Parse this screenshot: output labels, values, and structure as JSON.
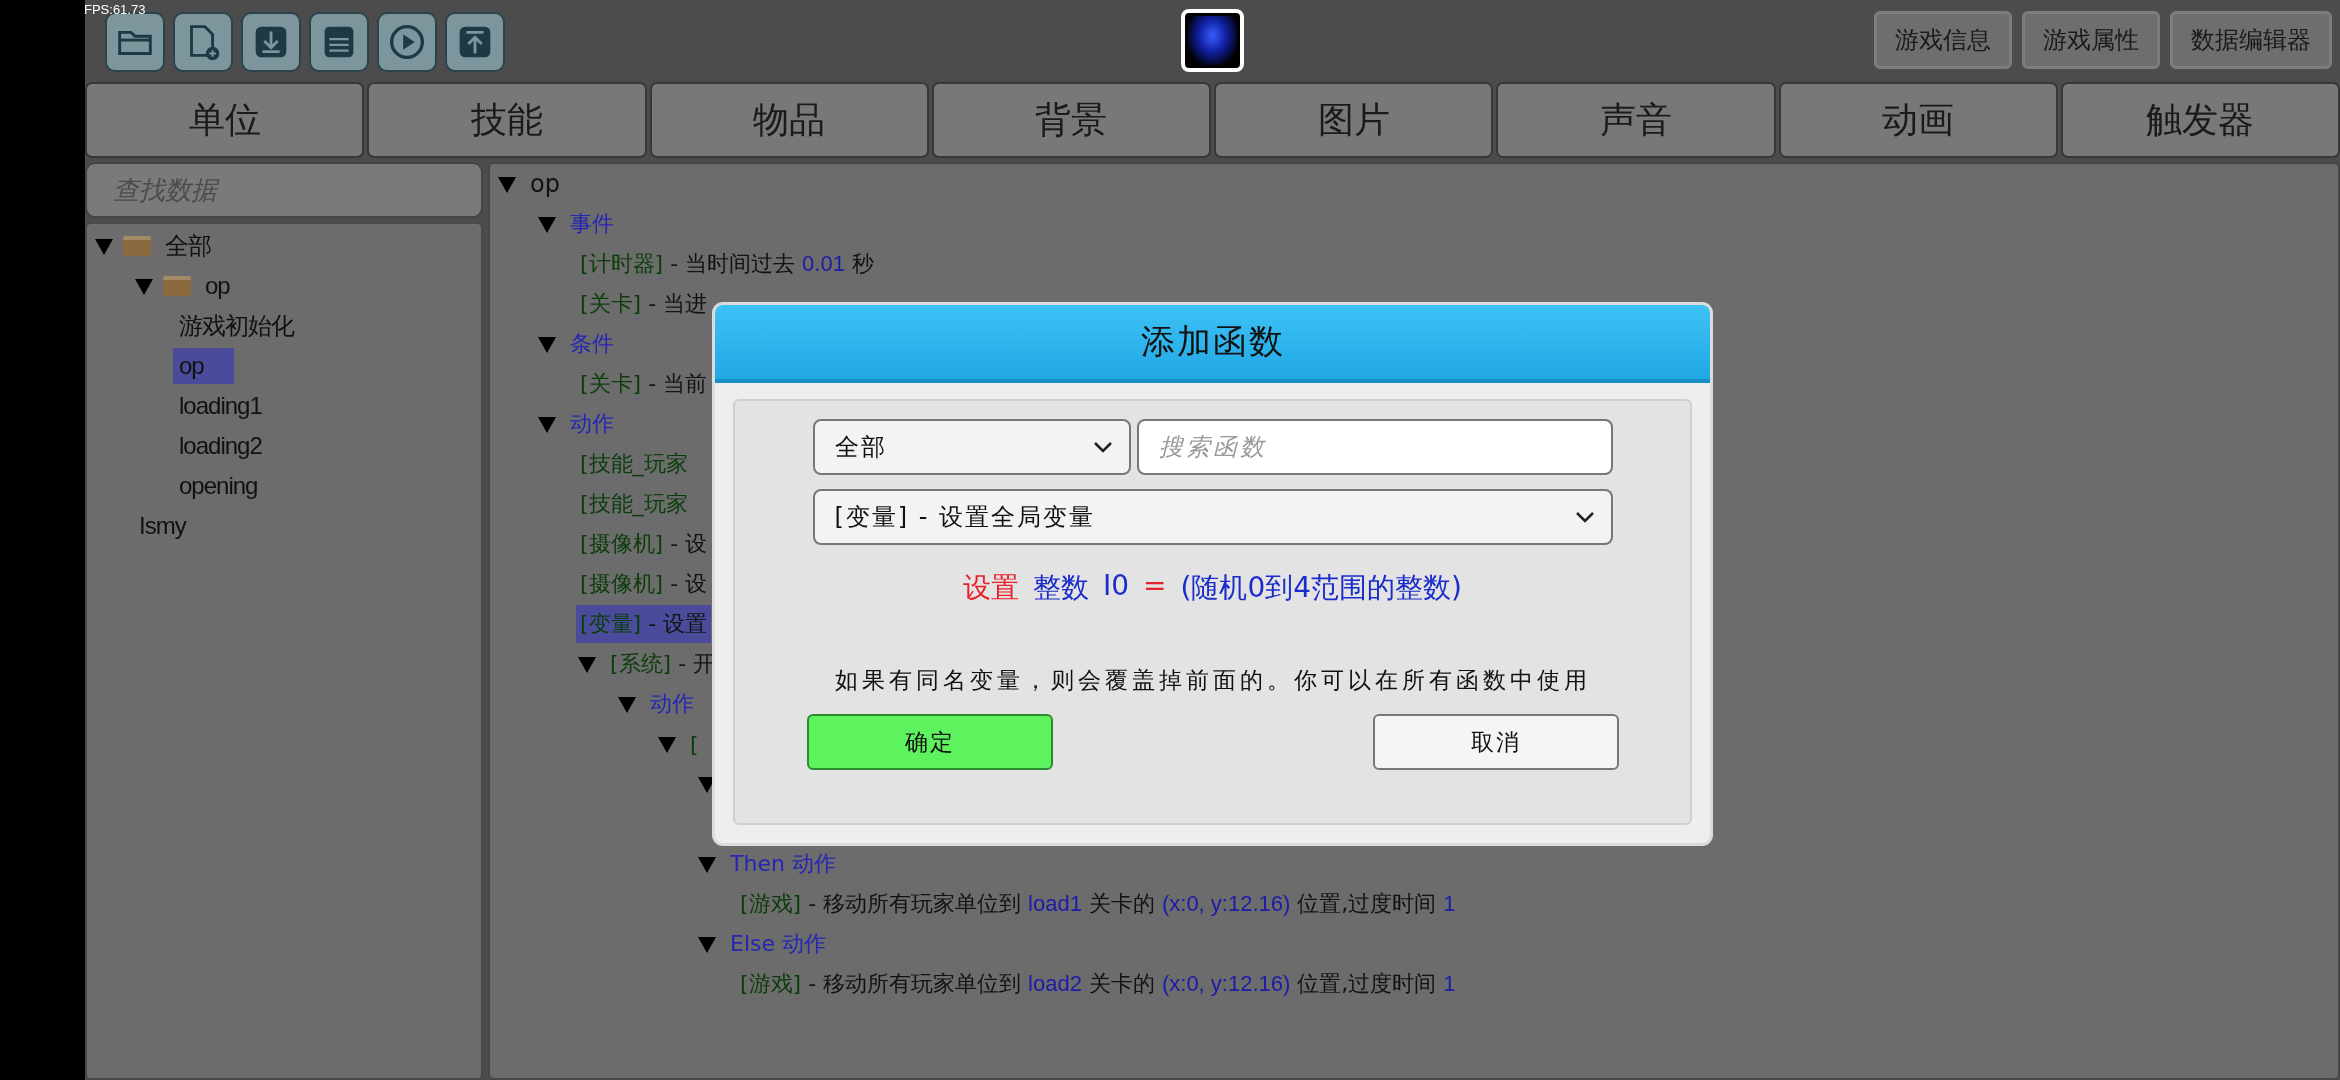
{
  "fps": "FPS:61.73",
  "header_buttons": [
    "游戏信息",
    "游戏属性",
    "数据编辑器"
  ],
  "tabs": [
    "单位",
    "技能",
    "物品",
    "背景",
    "图片",
    "声音",
    "动画",
    "触发器"
  ],
  "sidebar": {
    "search": {
      "placeholder": "查找数据"
    },
    "items": [
      {
        "label": "全部",
        "kind": "folder",
        "selected": false,
        "expanded": true,
        "children": [
          {
            "label": "op",
            "kind": "folder",
            "selected": false,
            "expanded": true,
            "children": [
              {
                "label": "游戏初始化",
                "kind": "item",
                "selected": false
              },
              {
                "label": "op",
                "kind": "item",
                "selected": true
              },
              {
                "label": "loading1",
                "kind": "item",
                "selected": false
              },
              {
                "label": "loading2",
                "kind": "item",
                "selected": false
              },
              {
                "label": "opening",
                "kind": "item",
                "selected": false
              }
            ]
          },
          {
            "label": "Ismy",
            "kind": "item",
            "selected": false
          }
        ]
      }
    ]
  },
  "trigger_tree": [
    {
      "parts": [
        {
          "text": "op",
          "kind": "text"
        }
      ],
      "selected": false,
      "expanded": true,
      "children": [
        {
          "parts": [
            {
              "text": "事件",
              "kind": "category"
            }
          ],
          "selected": false,
          "expanded": true,
          "children": [
            {
              "parts": [
                {
                  "text": "[计时器]",
                  "kind": "bracket"
                },
                {
                  "text": " - 当时间过去 ",
                  "kind": "text"
                },
                {
                  "text": "0.01",
                  "kind": "value"
                },
                {
                  "text": " 秒",
                  "kind": "text"
                }
              ],
              "selected": false
            },
            {
              "parts": [
                {
                  "text": "[关卡]",
                  "kind": "bracket"
                },
                {
                  "text": " - 当进",
                  "kind": "text"
                }
              ],
              "selected": false
            }
          ]
        },
        {
          "parts": [
            {
              "text": "条件",
              "kind": "category"
            }
          ],
          "selected": false,
          "expanded": true,
          "children": [
            {
              "parts": [
                {
                  "text": "[关卡]",
                  "kind": "bracket"
                },
                {
                  "text": " - 当前",
                  "kind": "text"
                }
              ],
              "selected": false
            }
          ]
        },
        {
          "parts": [
            {
              "text": "动作",
              "kind": "category"
            }
          ],
          "selected": false,
          "expanded": true,
          "children": [
            {
              "parts": [
                {
                  "text": "[技能_玩家",
                  "kind": "bracket"
                }
              ],
              "selected": false
            },
            {
              "parts": [
                {
                  "text": "[技能_玩家",
                  "kind": "bracket"
                }
              ],
              "selected": false
            },
            {
              "parts": [
                {
                  "text": "[摄像机]",
                  "kind": "bracket"
                },
                {
                  "text": " - 设",
                  "kind": "text"
                }
              ],
              "selected": false
            },
            {
              "parts": [
                {
                  "text": "[摄像机]",
                  "kind": "bracket"
                },
                {
                  "text": " - 设",
                  "kind": "text"
                }
              ],
              "selected": false
            },
            {
              "parts": [
                {
                  "text": "[变量]",
                  "kind": "bracket"
                },
                {
                  "text": " - 设置",
                  "kind": "text"
                }
              ],
              "selected": true
            },
            {
              "parts": [
                {
                  "text": "[系统]",
                  "kind": "bracket"
                },
                {
                  "text": " - 开",
                  "kind": "text"
                }
              ],
              "selected": false,
              "expanded": true,
              "children": [
                {
                  "parts": [
                    {
                      "text": "动作",
                      "kind": "category"
                    }
                  ],
                  "selected": false,
                  "expanded": true,
                  "children": [
                    {
                      "parts": [
                        {
                          "text": "[",
                          "kind": "bracket"
                        }
                      ],
                      "selected": false,
                      "expanded": true,
                      "children": [
                        {
                          "expanded": true
                        },
                        {
                          "parts": [
                            {
                              "text": "Then",
                              "kind": "category"
                            },
                            {
                              "text": " 动作",
                              "kind": "category"
                            }
                          ],
                          "selected": false,
                          "expanded": true,
                          "children": [
                            {
                              "parts": [
                                {
                                  "text": "[游戏]",
                                  "kind": "bracket"
                                },
                                {
                                  "text": " - 移动所有玩家单位到 ",
                                  "kind": "text"
                                },
                                {
                                  "text": "load1",
                                  "kind": "value"
                                },
                                {
                                  "text": " 关卡的 ",
                                  "kind": "text"
                                },
                                {
                                  "text": "(x:0, y:12.16)",
                                  "kind": "value"
                                },
                                {
                                  "text": " 位置,过度时间 ",
                                  "kind": "text"
                                },
                                {
                                  "text": "1",
                                  "kind": "value"
                                }
                              ],
                              "selected": false
                            }
                          ]
                        },
                        {
                          "parts": [
                            {
                              "text": "Else",
                              "kind": "category"
                            },
                            {
                              "text": " 动作",
                              "kind": "category"
                            }
                          ],
                          "selected": false,
                          "expanded": true,
                          "children": [
                            {
                              "parts": [
                                {
                                  "text": "[游戏]",
                                  "kind": "bracket"
                                },
                                {
                                  "text": " - 移动所有玩家单位到 ",
                                  "kind": "text"
                                },
                                {
                                  "text": "load2",
                                  "kind": "value"
                                },
                                {
                                  "text": " 关卡的 ",
                                  "kind": "text"
                                },
                                {
                                  "text": "(x:0, y:12.16)",
                                  "kind": "value"
                                },
                                {
                                  "text": " 位置,过度时间 ",
                                  "kind": "text"
                                },
                                {
                                  "text": "1",
                                  "kind": "value"
                                }
                              ],
                              "selected": false
                            }
                          ]
                        }
                      ]
                    }
                  ]
                }
              ]
            }
          ]
        }
      ]
    }
  ],
  "dialog": {
    "title": "添加函数",
    "category_select": {
      "value": "全部"
    },
    "search": {
      "placeholder": "搜索函数"
    },
    "function_select": {
      "value": "[变量] - 设置全局变量"
    },
    "expression": [
      {
        "text": "设置",
        "kind": "keyword"
      },
      {
        "text": "整数",
        "kind": "type"
      },
      {
        "text": "I0",
        "kind": "name"
      },
      {
        "text": "=",
        "kind": "keyword"
      },
      {
        "text": "(随机0到4范围的整数)",
        "kind": "name"
      }
    ],
    "description": "如果有同名变量，则会覆盖掉前面的。你可以在所有函数中使用",
    "buttons": [
      {
        "label": "确定",
        "kind": "primary"
      },
      {
        "label": "取消",
        "kind": "secondary"
      }
    ]
  }
}
